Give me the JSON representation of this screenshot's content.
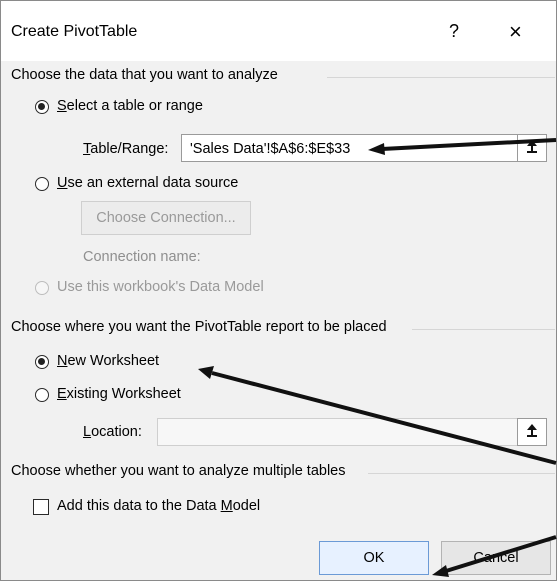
{
  "dialog": {
    "title": "Create PivotTable",
    "help": "?",
    "close": "×"
  },
  "section1": {
    "title": "Choose the data that you want to analyze",
    "options": {
      "select_table_range": {
        "label_prefix": "",
        "label_underlined": "S",
        "label_rest": "elect a table or range"
      },
      "external_source": {
        "label_prefix": "",
        "label_underlined": "U",
        "label_rest": "se an external data source"
      },
      "data_model": {
        "label": "Use this workbook's Data Model"
      }
    },
    "table_range_label": {
      "underlined": "T",
      "rest": "able/Range:"
    },
    "table_range_value": "'Sales Data'!$A$6:$E$33",
    "choose_connection_label": "Choose Connection...",
    "connection_name_label": "Connection name:"
  },
  "section2": {
    "title": "Choose where you want the PivotTable report to be placed",
    "options": {
      "new_worksheet": {
        "underlined": "N",
        "rest": "ew Worksheet"
      },
      "existing_worksheet": {
        "underlined": "E",
        "rest": "xisting Worksheet"
      }
    },
    "location_label": {
      "underlined": "L",
      "rest": "ocation:"
    },
    "location_value": ""
  },
  "section3": {
    "title": "Choose whether you want to analyze multiple tables",
    "checkbox_label": {
      "prefix": "Add this data to the Data ",
      "underlined": "M",
      "rest": "odel"
    }
  },
  "buttons": {
    "ok": "OK",
    "cancel": "Cancel"
  },
  "icons": {
    "upload_arrow": "up-arrow-icon"
  }
}
